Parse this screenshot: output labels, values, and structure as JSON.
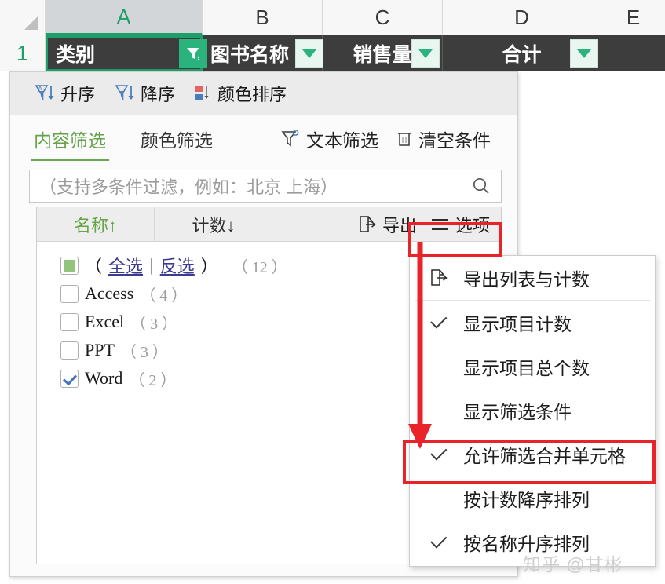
{
  "spreadsheet": {
    "columns": [
      {
        "label": "A",
        "selected": true
      },
      {
        "label": "B",
        "selected": false
      },
      {
        "label": "C",
        "selected": false
      },
      {
        "label": "D",
        "selected": false
      },
      {
        "label": "E",
        "selected": false
      }
    ],
    "row_number": "1",
    "header_cells": [
      {
        "text": "类别",
        "filtered": true
      },
      {
        "text": "图书名称",
        "filtered": false
      },
      {
        "text": "销售量",
        "filtered": false
      },
      {
        "text": "合计",
        "filtered": false
      }
    ]
  },
  "panel": {
    "sort_toolbar": [
      {
        "icon": "sort-ascending-icon",
        "label": "升序"
      },
      {
        "icon": "sort-descending-icon",
        "label": "降序"
      },
      {
        "icon": "sort-by-color-icon",
        "label": "颜色排序"
      }
    ],
    "tabs": [
      {
        "label": "内容筛选",
        "active": true
      },
      {
        "label": "颜色筛选",
        "active": false
      }
    ],
    "tools": [
      {
        "icon": "text-filter-icon",
        "label": "文本筛选"
      },
      {
        "icon": "trash-icon",
        "label": "清空条件"
      }
    ],
    "search": {
      "placeholder": "（支持多条件过滤，例如：北京 上海）",
      "value": "",
      "icon": "search-icon"
    },
    "list_header": {
      "name_column": "名称↑",
      "count_column": "计数↓",
      "export_label": "导出",
      "export_icon": "export-icon",
      "options_label": "选项",
      "options_icon": "hamburger-icon"
    },
    "items": [
      {
        "type": "selectall",
        "state": "partial",
        "open_paren": "（",
        "select_all": "全选",
        "divider": "|",
        "invert": "反选",
        "close_paren": "）",
        "count": "（ 12 ）"
      },
      {
        "type": "item",
        "state": "unchecked",
        "label": "Access",
        "count": "（ 4 ）"
      },
      {
        "type": "item",
        "state": "unchecked",
        "label": "Excel",
        "count": "（ 3 ）"
      },
      {
        "type": "item",
        "state": "unchecked",
        "label": "PPT",
        "count": "（ 3 ）"
      },
      {
        "type": "item",
        "state": "checked",
        "label": "Word",
        "count": "（ 2 ）"
      }
    ]
  },
  "options_menu": [
    {
      "label": "导出列表与计数",
      "icon": "export-icon",
      "checked": false,
      "separator_after": true
    },
    {
      "label": "显示项目计数",
      "icon": "check-icon",
      "checked": true,
      "separator_after": false
    },
    {
      "label": "显示项目总个数",
      "icon": "",
      "checked": false,
      "separator_after": false
    },
    {
      "label": "显示筛选条件",
      "icon": "",
      "checked": false,
      "separator_after": false
    },
    {
      "label": "允许筛选合并单元格",
      "icon": "check-icon",
      "checked": true,
      "separator_after": false,
      "highlighted": true
    },
    {
      "label": "按计数降序排列",
      "icon": "",
      "checked": false,
      "separator_after": false
    },
    {
      "label": "按名称升序排列",
      "icon": "check-icon",
      "checked": true,
      "separator_after": false
    }
  ],
  "annotation": {
    "color": "#e8232a",
    "arrow_from": "options-button",
    "arrow_to": "allow-filter-merged-cells-item"
  },
  "watermark": "知乎 @甘彬",
  "colors": {
    "accent_green": "#1e9e6a",
    "tab_green": "#6aa84f",
    "header_dark": "#3d3d3d",
    "annotation_red": "#e8232a"
  }
}
